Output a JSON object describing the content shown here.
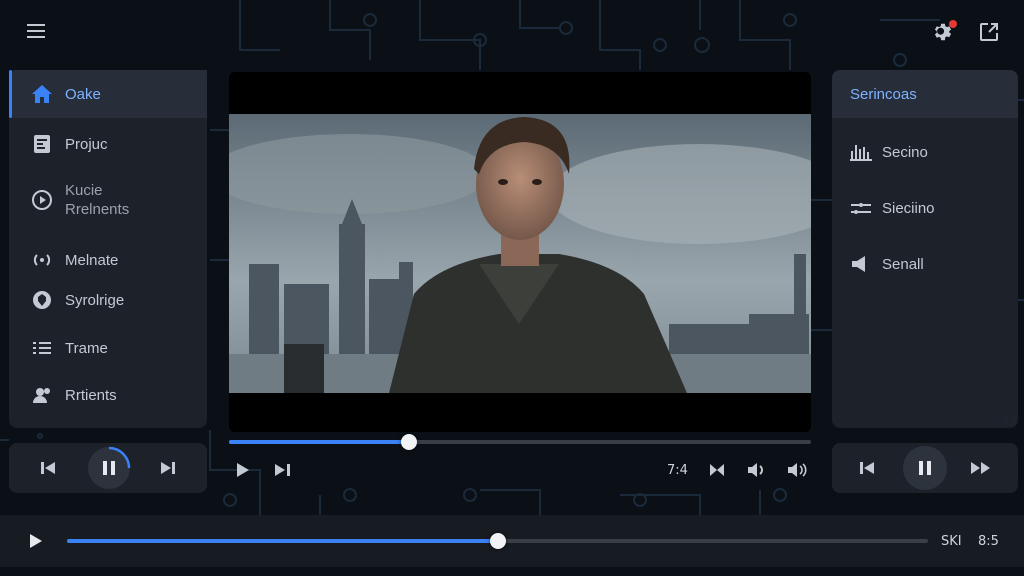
{
  "topbar": {
    "menu_icon": "hamburger-icon",
    "settings_icon": "gear-icon",
    "settings_badge_color": "#e53935",
    "share_icon": "share-icon"
  },
  "sidebar": {
    "items": [
      {
        "label": "Oake",
        "icon": "home-icon",
        "active": true
      },
      {
        "label": "Projuc",
        "icon": "document-icon"
      },
      {
        "label": "Kucie\nRrelnents",
        "icon": "play-circle-icon"
      },
      {
        "label": "Melnate",
        "icon": "broadcast-icon"
      },
      {
        "label": "Syrolrige",
        "icon": "shield-icon"
      },
      {
        "label": "Trame",
        "icon": "list-icon"
      },
      {
        "label": "Rrtients",
        "icon": "users-icon"
      }
    ]
  },
  "video": {
    "progress": 0.31
  },
  "video_controls": {
    "time_label": "7:4",
    "icons": [
      "play-icon",
      "skip-next-icon",
      "skip-next-icon",
      "volume-icon",
      "volume-icon"
    ]
  },
  "right_panel": {
    "header": "Serincoas",
    "items": [
      {
        "label": "Secino",
        "icon": "equalizer-icon"
      },
      {
        "label": "Sieciino",
        "icon": "sliders-icon"
      },
      {
        "label": "Senall",
        "icon": "speaker-icon"
      }
    ]
  },
  "left_controls": {
    "icons": [
      "skip-previous-icon",
      "pause-icon",
      "skip-next-icon"
    ],
    "accent": "#3b82f6"
  },
  "right_controls": {
    "icons": [
      "skip-previous-icon",
      "pause-icon",
      "fast-forward-icon"
    ]
  },
  "bottom_bar": {
    "progress": 0.5,
    "time_elapsed": "SKI",
    "time_total": "8:5"
  },
  "colors": {
    "accent": "#3b82f6",
    "background": "#0b1017",
    "panel": "#1e232c"
  }
}
